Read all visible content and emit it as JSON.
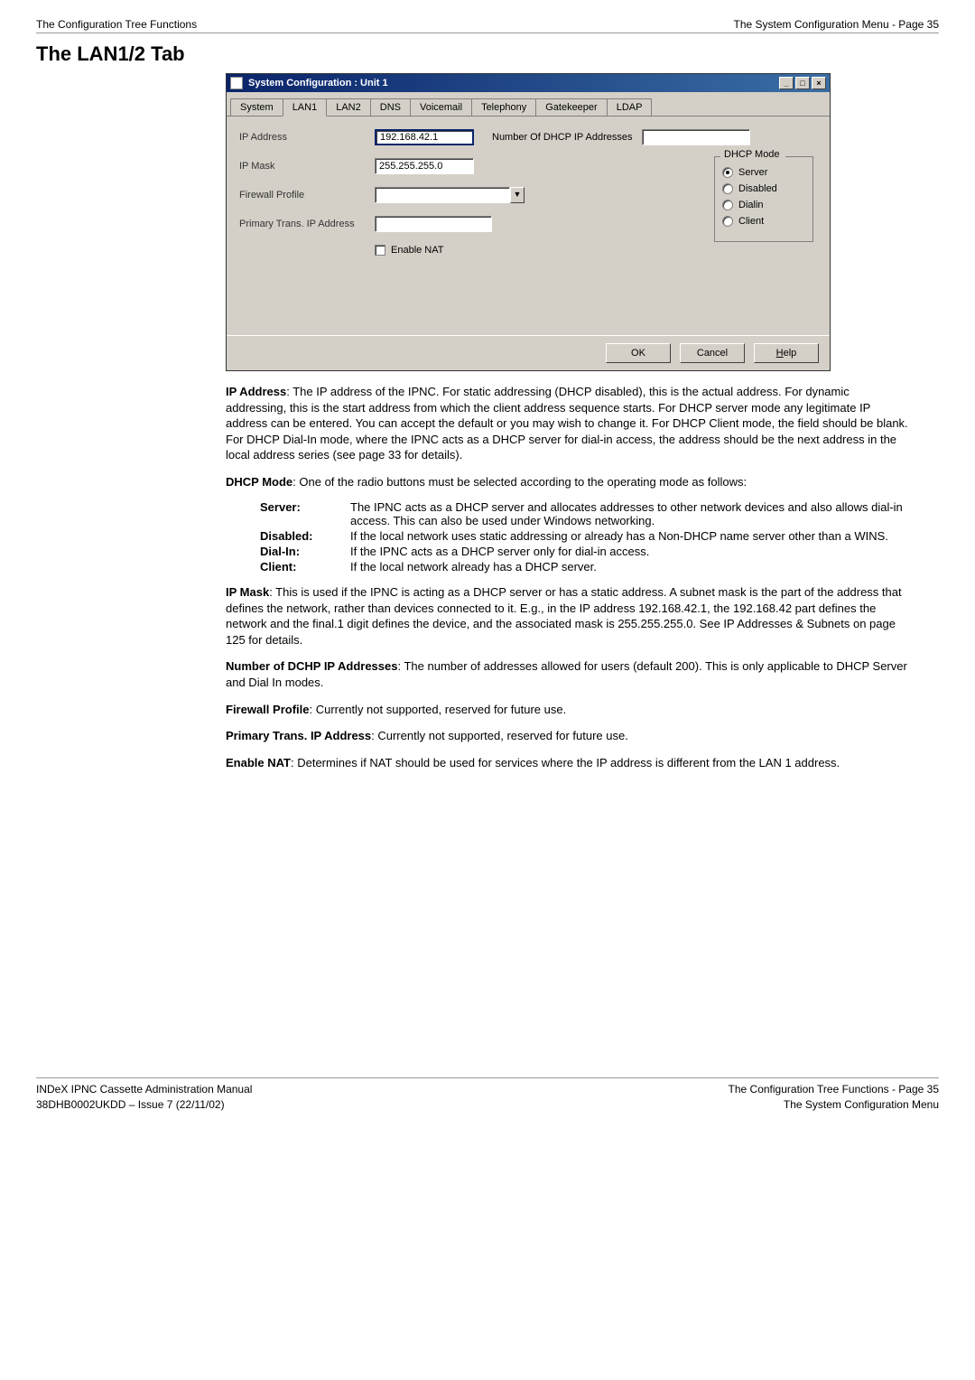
{
  "header": {
    "left": "The Configuration Tree Functions",
    "right": "The System Configuration Menu - Page 35"
  },
  "section_title": "The LAN1/2 Tab",
  "dialog": {
    "title": "System Configuration : Unit 1",
    "win_btns": {
      "min": "_",
      "max": "□",
      "close": "×"
    },
    "tabs": [
      "System",
      "LAN1",
      "LAN2",
      "DNS",
      "Voicemail",
      "Telephony",
      "Gatekeeper",
      "LDAP"
    ],
    "active_tab_index": 1,
    "labels": {
      "ip_address": "IP Address",
      "ip_mask": "IP Mask",
      "firewall_profile": "Firewall Profile",
      "primary_trans": "Primary Trans. IP Address",
      "num_dhcp": "Number Of DHCP IP Addresses",
      "enable_nat": "Enable NAT",
      "dhcp_mode": "DHCP Mode"
    },
    "values": {
      "ip_address": "192.168.42.1",
      "ip_mask": "255.255.255.0",
      "num_dhcp": "",
      "firewall_profile": "",
      "primary_trans": ""
    },
    "dhcp_options": [
      {
        "label": "Server",
        "checked": true
      },
      {
        "label": "Disabled",
        "checked": false
      },
      {
        "label": "Dialin",
        "checked": false
      },
      {
        "label": "Client",
        "checked": false
      }
    ],
    "buttons": {
      "ok": "OK",
      "cancel": "Cancel",
      "help_prefix": "H",
      "help_rest": "elp"
    }
  },
  "paragraphs": {
    "ip_address_head": "IP Address",
    "ip_address_body": ": The IP address of the IPNC. For static addressing (DHCP disabled), this is the actual address. For dynamic addressing, this is the start address from which the client address sequence starts. For DHCP server mode any legitimate IP address can be entered. You can accept the default or you may wish to change it. For DHCP Client mode, the field should be blank. For DHCP Dial-In mode, where the IPNC acts as a DHCP server for dial-in access, the address should be the next address in the local address series (see page 33 for details).",
    "dhcp_mode_head": "DHCP Mode",
    "dhcp_mode_body": ": One of the radio buttons must be selected according to the operating mode as follows:",
    "defs": [
      {
        "term": "Server:",
        "desc": "The IPNC acts as a DHCP server and allocates addresses to other network devices and also allows dial-in access. This can also be used under Windows networking."
      },
      {
        "term": "Disabled:",
        "desc": "If the local network uses static addressing or already has a Non-DHCP name server other than a WINS."
      },
      {
        "term": "Dial-In:",
        "desc": "If the IPNC acts as a DHCP server only for dial-in access."
      },
      {
        "term": "Client:",
        "desc": "If the local network already has a DHCP server."
      }
    ],
    "ip_mask_head": "IP Mask",
    "ip_mask_body": ": This is used if the IPNC is acting as a DHCP server or has a static address. A subnet mask is the part of the address that defines the network, rather than devices connected to it. E.g., in the IP address 192.168.42.1, the 192.168.42 part defines the network and the final.1 digit defines the device, and the associated mask is 255.255.255.0. See IP Addresses & Subnets on page 125 for details.",
    "num_dhcp_head": "Number of DCHP IP Addresses",
    "num_dhcp_body": ": The number of addresses allowed for users (default 200). This is only applicable to DHCP Server and Dial In modes.",
    "firewall_head": "Firewall Profile",
    "firewall_body": ": Currently not supported, reserved for future use.",
    "primary_head": "Primary Trans. IP Address",
    "primary_body": ": Currently not supported, reserved for future use.",
    "nat_head": "Enable NAT",
    "nat_body": ": Determines if NAT should be used for services where the IP address is different from the LAN 1 address."
  },
  "footer": {
    "left1": "INDeX IPNC Cassette Administration Manual",
    "left2": "38DHB0002UKDD – Issue 7 (22/11/02)",
    "right1": "The Configuration Tree Functions - Page 35",
    "right2": "The System Configuration Menu"
  }
}
